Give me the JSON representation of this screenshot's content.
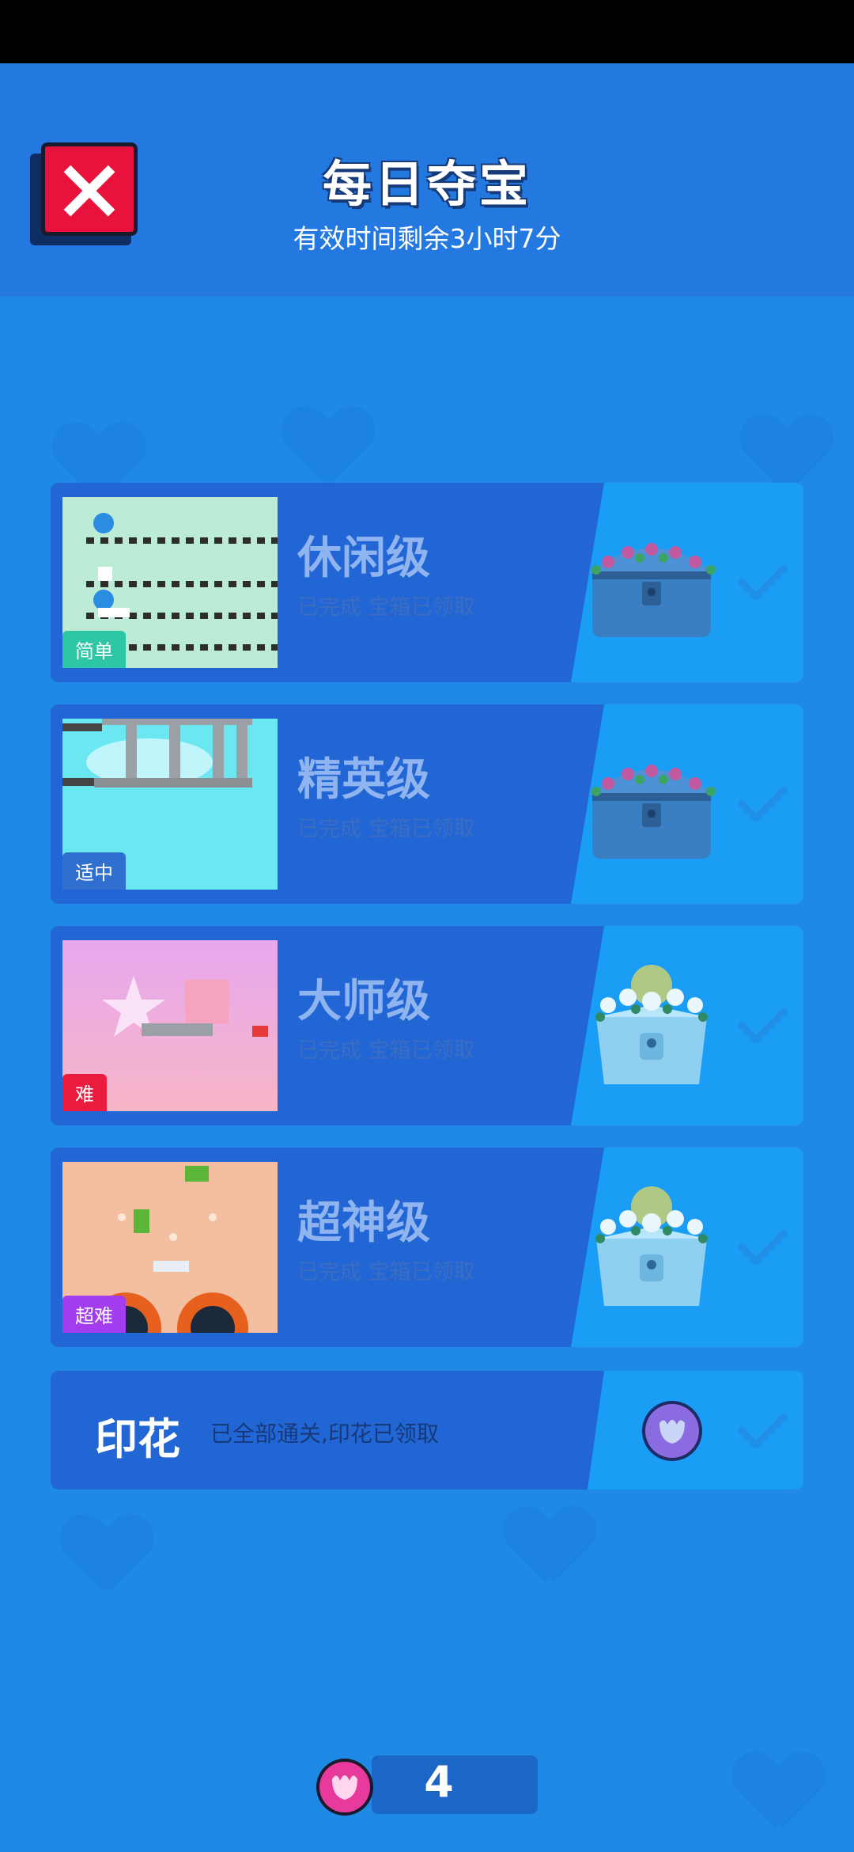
{
  "header": {
    "title": "每日夺宝",
    "subtitle": "有效时间剩余3小时7分"
  },
  "levels": [
    {
      "title": "休闲级",
      "status": "已完成 宝箱已领取",
      "difficulty": "简单",
      "tag_color": "#2ec7a6",
      "chest": "blue-flower-chest-icon",
      "completed": true
    },
    {
      "title": "精英级",
      "status": "已完成 宝箱已领取",
      "difficulty": "适中",
      "tag_color": "#2f6fcf",
      "chest": "blue-flower-chest-icon",
      "completed": true
    },
    {
      "title": "大师级",
      "status": "已完成 宝箱已领取",
      "difficulty": "难",
      "tag_color": "#ea1b3d",
      "chest": "crystal-flower-chest-icon",
      "completed": true
    },
    {
      "title": "超神级",
      "status": "已完成 宝箱已领取",
      "difficulty": "超难",
      "tag_color": "#a43cf0",
      "chest": "crystal-flower-chest-icon",
      "completed": true
    }
  ],
  "stamp": {
    "label": "印花",
    "status": "已全部通关,印花已领取",
    "icon": "tulip-stamp-icon",
    "completed": true
  },
  "footer": {
    "count": "4",
    "icon": "tulip-stamp-icon"
  },
  "colors": {
    "background": "#1f8ae6",
    "header": "#2479e0",
    "card_left": "#2166d4",
    "card_right": "#1a9df5",
    "close_button": "#e8123c"
  }
}
